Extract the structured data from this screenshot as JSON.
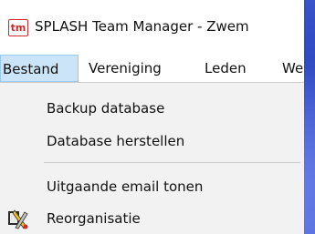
{
  "app": {
    "icon_text": "tm",
    "title": "SPLASH Team Manager - Zwem"
  },
  "menubar": {
    "items": [
      "Bestand",
      "Vereniging",
      "Leden",
      "We"
    ],
    "active": "Bestand"
  },
  "dropdown": {
    "items": [
      {
        "label": "Backup database",
        "icon": ""
      },
      {
        "label": "Database herstellen",
        "icon": ""
      },
      {
        "label": "Uitgaande email tonen",
        "icon": ""
      },
      {
        "label": "Reorganisatie",
        "icon": "reorganize-tools-icon"
      }
    ]
  },
  "colors": {
    "background": "#3f56c9",
    "menu_highlight": "#cce4f7",
    "dropdown_bg": "#f2f2f2",
    "brand_red": "#d12a2a"
  }
}
